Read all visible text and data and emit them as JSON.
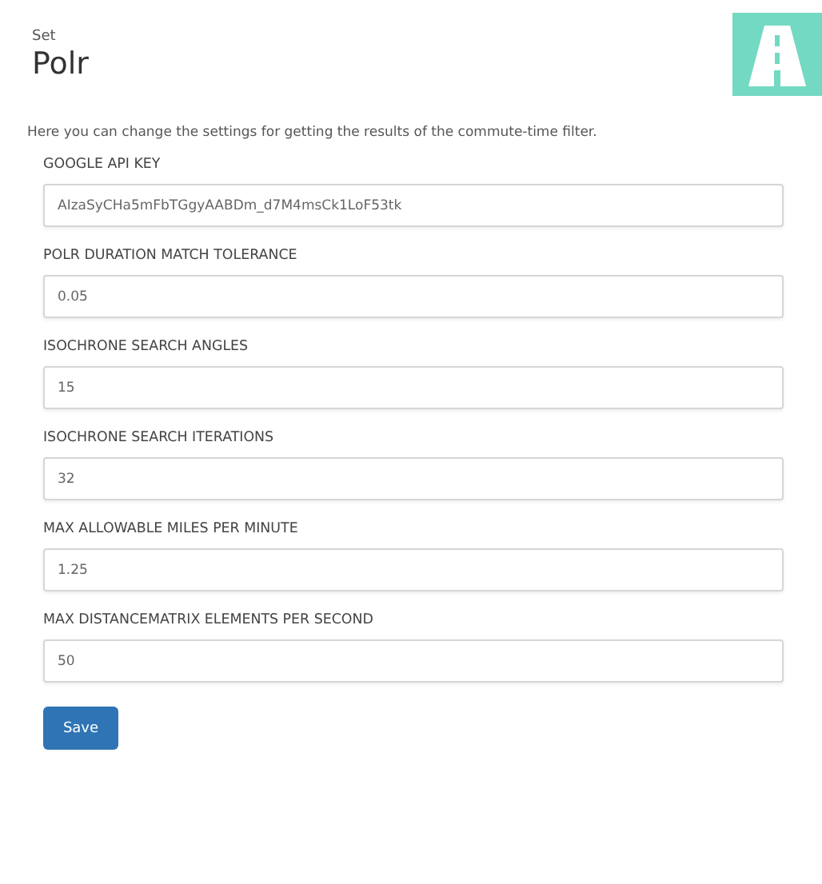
{
  "header": {
    "eyebrow": "Set",
    "title": "Polr"
  },
  "description": "Here you can change the settings for getting the results of the commute-time filter.",
  "fields": [
    {
      "label": "GOOGLE API KEY",
      "value": "AIzaSyCHa5mFbTGgyAABDm_d7M4msCk1LoF53tk"
    },
    {
      "label": "POLR DURATION MATCH TOLERANCE",
      "value": "0.05"
    },
    {
      "label": "ISOCHRONE SEARCH ANGLES",
      "value": "15"
    },
    {
      "label": "ISOCHRONE SEARCH ITERATIONS",
      "value": "32"
    },
    {
      "label": "MAX ALLOWABLE MILES PER MINUTE",
      "value": "1.25"
    },
    {
      "label": "MAX DISTANCEMATRIX ELEMENTS PER SECOND",
      "value": "50"
    }
  ],
  "save_button": "Save"
}
